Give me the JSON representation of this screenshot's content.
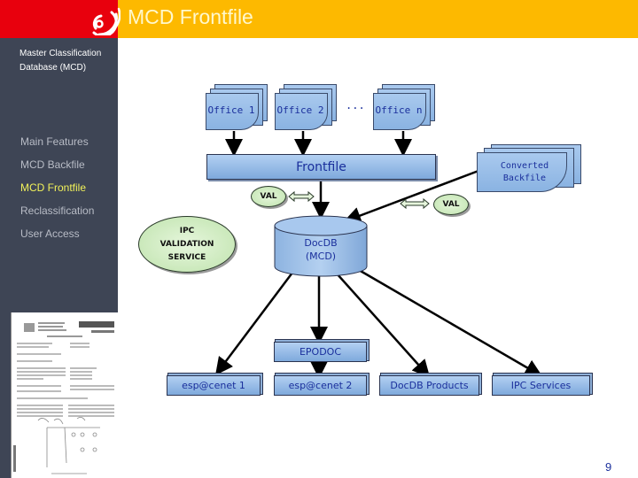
{
  "header": {
    "title": "MCD Frontfile",
    "logo": "epo-logo-icon"
  },
  "sidebar": {
    "subtitle_line1": "Master Classification",
    "subtitle_line2": "Database (MCD)",
    "items": [
      {
        "label": "Main Features",
        "active": false
      },
      {
        "label": "MCD Backfile",
        "active": false
      },
      {
        "label": "MCD Frontfile",
        "active": true
      },
      {
        "label": "Reclassification",
        "active": false
      },
      {
        "label": "User Access",
        "active": false
      }
    ],
    "active_color": "#f2f25a"
  },
  "diagram": {
    "offices": [
      "Office 1",
      "Office 2",
      "Office n"
    ],
    "ellipsis": "...",
    "frontfile": "Frontfile",
    "converted_line1": "Converted",
    "converted_line2": "Backfile",
    "val_left": "VAL",
    "val_right": "VAL",
    "ipc_line1": "IPC",
    "ipc_line2": "VALIDATION",
    "ipc_line3": "SERVICE",
    "docdb_line1": "DocDB",
    "docdb_line2": "(MCD)",
    "epodoc": "EPODOC",
    "outputs": [
      "esp@cenet 1",
      "esp@cenet 2",
      "DocDB Products",
      "IPC Services"
    ]
  },
  "footer": {
    "page_number": "9"
  },
  "colors": {
    "header_red": "#e8000d",
    "header_yellow": "#fdb900",
    "sidebar_bg": "#3e4555",
    "box_blue": "#8ab3e2",
    "text_blue": "#1a2f9c",
    "val_green": "#bfe3ad"
  }
}
